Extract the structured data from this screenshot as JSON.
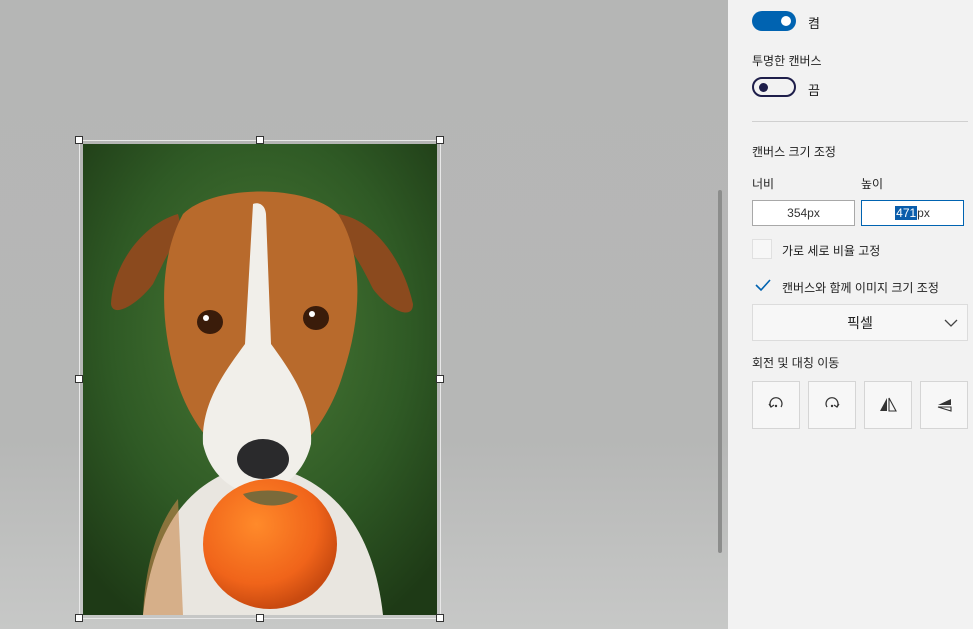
{
  "panel": {
    "toggle_top": {
      "state_label": "켬",
      "on": true
    },
    "transparent_canvas": {
      "label": "투명한 캔버스",
      "state_label": "끔",
      "on": false
    },
    "resize": {
      "heading": "캔버스 크기 조정",
      "width_label": "너비",
      "height_label": "높이",
      "width_value": "354px",
      "height_value_selected": "471",
      "height_value_unit": "px",
      "lock_aspect_label": "가로 세로 비율 고정",
      "lock_aspect_checked": false,
      "resize_image_label": "캔버스와 함께 이미지 크기 조정",
      "resize_image_checked": true,
      "unit_dropdown": "픽셀"
    },
    "rotate_flip": {
      "heading": "회전 및 대칭 이동",
      "buttons": [
        "rotate-left-icon",
        "rotate-right-icon",
        "flip-horizontal-icon",
        "flip-vertical-icon"
      ]
    }
  },
  "colors": {
    "accent": "#0063b1",
    "canvas_bg": "#b5b6b5",
    "panel_bg": "#f2f2f2"
  }
}
